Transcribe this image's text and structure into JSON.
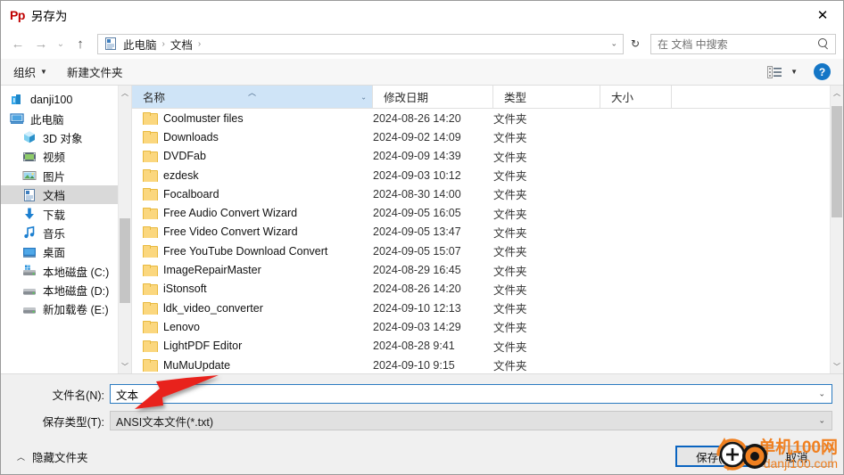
{
  "window": {
    "app_logo": "Pp",
    "title": "另存为",
    "close_label": "✕"
  },
  "nav": {
    "back_icon": "←",
    "forward_icon": "→",
    "history_icon": "⌄",
    "up_icon": "↑",
    "breadcrumb_icon": "documents-icon",
    "breadcrumb": [
      "此电脑",
      "文档"
    ],
    "separator": "›",
    "dropdown_icon": "⌄",
    "refresh_icon": "↻",
    "search_placeholder": "在 文档 中搜索",
    "search_value": ""
  },
  "toolbar": {
    "organize_label": "组织",
    "organize_caret": "▼",
    "new_folder_label": "新建文件夹",
    "view_caret": "▼",
    "help_label": "?"
  },
  "sidebar": {
    "items": [
      {
        "label": "danji100",
        "icon": "cloud-folder-icon",
        "indent": false,
        "selected": false
      },
      {
        "label": "此电脑",
        "icon": "this-pc-icon",
        "indent": false,
        "selected": false
      },
      {
        "label": "3D 对象",
        "icon": "3d-objects-icon",
        "indent": true,
        "selected": false
      },
      {
        "label": "视频",
        "icon": "videos-icon",
        "indent": true,
        "selected": false
      },
      {
        "label": "图片",
        "icon": "pictures-icon",
        "indent": true,
        "selected": false
      },
      {
        "label": "文档",
        "icon": "documents-icon",
        "indent": true,
        "selected": true
      },
      {
        "label": "下载",
        "icon": "downloads-icon",
        "indent": true,
        "selected": false
      },
      {
        "label": "音乐",
        "icon": "music-icon",
        "indent": true,
        "selected": false
      },
      {
        "label": "桌面",
        "icon": "desktop-icon",
        "indent": true,
        "selected": false
      },
      {
        "label": "本地磁盘 (C:)",
        "icon": "system-drive-icon",
        "indent": true,
        "selected": false
      },
      {
        "label": "本地磁盘 (D:)",
        "icon": "drive-icon",
        "indent": true,
        "selected": false
      },
      {
        "label": "新加载卷 (E:)",
        "icon": "drive-icon",
        "indent": true,
        "selected": false
      }
    ]
  },
  "filelist": {
    "columns": {
      "name": "名称",
      "date": "修改日期",
      "type": "类型",
      "size": "大小"
    },
    "sort_caret": "︿",
    "header_chevron": "⌄",
    "rows": [
      {
        "name": "Coolmuster files",
        "date": "2024-08-26 14:20",
        "type": "文件夹",
        "size": ""
      },
      {
        "name": "Downloads",
        "date": "2024-09-02 14:09",
        "type": "文件夹",
        "size": ""
      },
      {
        "name": "DVDFab",
        "date": "2024-09-09 14:39",
        "type": "文件夹",
        "size": ""
      },
      {
        "name": "ezdesk",
        "date": "2024-09-03 10:12",
        "type": "文件夹",
        "size": ""
      },
      {
        "name": "Focalboard",
        "date": "2024-08-30 14:00",
        "type": "文件夹",
        "size": ""
      },
      {
        "name": "Free Audio Convert Wizard",
        "date": "2024-09-05 16:05",
        "type": "文件夹",
        "size": ""
      },
      {
        "name": "Free Video Convert Wizard",
        "date": "2024-09-05 13:47",
        "type": "文件夹",
        "size": ""
      },
      {
        "name": "Free YouTube Download Convert",
        "date": "2024-09-05 15:07",
        "type": "文件夹",
        "size": ""
      },
      {
        "name": "ImageRepairMaster",
        "date": "2024-08-29 16:45",
        "type": "文件夹",
        "size": ""
      },
      {
        "name": "iStonsoft",
        "date": "2024-08-26 14:20",
        "type": "文件夹",
        "size": ""
      },
      {
        "name": "ldk_video_converter",
        "date": "2024-09-10 12:13",
        "type": "文件夹",
        "size": ""
      },
      {
        "name": "Lenovo",
        "date": "2024-09-03 14:29",
        "type": "文件夹",
        "size": ""
      },
      {
        "name": "LightPDF Editor",
        "date": "2024-08-28 9:41",
        "type": "文件夹",
        "size": ""
      },
      {
        "name": "MuMuUpdate",
        "date": "2024-09-10 9:15",
        "type": "文件夹",
        "size": ""
      }
    ]
  },
  "form": {
    "filename_label": "文件名(N):",
    "filename_value": "文本",
    "savetype_label": "保存类型(T):",
    "savetype_value": "ANSI文本文件(*.txt)",
    "combo_chevron": "⌄"
  },
  "footer": {
    "hide_folders_caret": "︿",
    "hide_folders_label": "隐藏文件夹",
    "save_label": "保存(S)",
    "cancel_label": "取消"
  },
  "watermark": {
    "line1": "单机100网",
    "line2": "danji100.com",
    "color": "#f08020"
  },
  "annotations": {
    "arrow_color": "#e8241f",
    "cursor_ring_color": "#f08020"
  }
}
